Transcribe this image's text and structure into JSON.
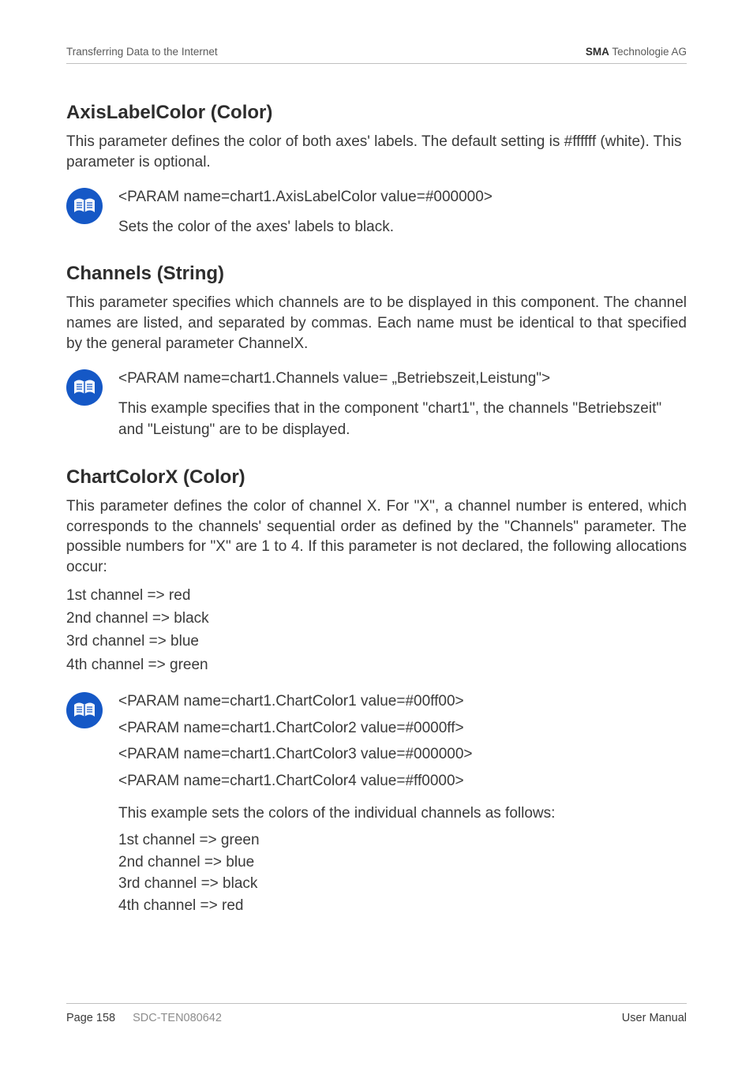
{
  "header": {
    "left": "Transferring Data to the Internet",
    "brand_strong": "SMA",
    "brand_rest": " Technologie AG"
  },
  "sections": {
    "axis": {
      "title": "AxisLabelColor (Color)",
      "desc": "This parameter defines the color of both axes' labels. The default setting is #ffffff (white). This parameter is optional.",
      "code": "<PARAM name=chart1.AxisLabelColor value=#000000>",
      "expl": "Sets the color of the axes' labels to black."
    },
    "channels": {
      "title": "Channels (String)",
      "desc": "This parameter specifies which channels are to be displayed in this component. The channel names are listed, and separated by commas. Each name must be identical to that specified by the general parameter ChannelX.",
      "code": "<PARAM name=chart1.Channels value= „Betriebszeit,Leistung\">",
      "expl": "This example specifies that in the component \"chart1\", the channels \"Betriebszeit\" and \"Leistung\" are to be displayed."
    },
    "chartcolor": {
      "title": "ChartColorX (Color)",
      "desc": "This parameter defines the color of channel X. For \"X\", a channel number is entered, which corresponds to the channels' sequential order as defined by the \"Channels\" parameter. The possible numbers for \"X\" are 1 to 4. If this parameter is not declared, the following allocations occur:",
      "defaults": [
        "1st channel => red",
        "2nd channel => black",
        "3rd channel => blue",
        "4th channel => green"
      ],
      "code": [
        "<PARAM name=chart1.ChartColor1 value=#00ff00>",
        "<PARAM name=chart1.ChartColor2 value=#0000ff>",
        "<PARAM name=chart1.ChartColor3 value=#000000>",
        "<PARAM name=chart1.ChartColor4 value=#ff0000>"
      ],
      "expl_intro": "This example sets the colors of the individual channels as follows:",
      "expl_list": [
        "1st channel => green",
        "2nd channel => blue",
        "3rd channel => black",
        "4th channel => red"
      ]
    }
  },
  "footer": {
    "page_label": "Page 158",
    "doc_code": "SDC-TEN080642",
    "right": "User Manual"
  },
  "icon_name": "book-icon"
}
